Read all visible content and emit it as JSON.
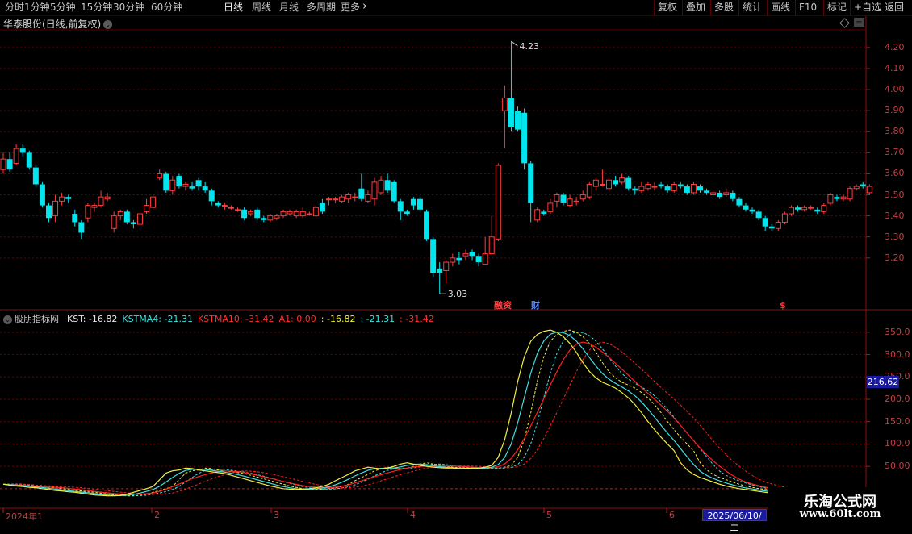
{
  "toolbar": {
    "periods": [
      "分时",
      "1分钟",
      "5分钟",
      "15分钟",
      "30分钟",
      "60分钟",
      "日线",
      "周线",
      "月线",
      "多周期",
      "更多"
    ],
    "active_period": "日线",
    "right_buttons": [
      "复权",
      "叠加",
      "多股",
      "统计",
      "画线",
      "F10",
      "标记",
      "+自选",
      "返回"
    ]
  },
  "stock": {
    "title": "华泰股份(日线,前复权)",
    "high_marker": "4.23",
    "low_marker": "3.03"
  },
  "event_markers": [
    {
      "label": "融资",
      "color": "#ff4040"
    },
    {
      "label": "财",
      "color": "#6090ff"
    },
    {
      "label": "$",
      "color": "#ff3030"
    }
  ],
  "price_axis": [
    "4.20",
    "4.10",
    "4.00",
    "3.90",
    "3.80",
    "3.70",
    "3.60",
    "3.50",
    "3.40",
    "3.30",
    "3.20"
  ],
  "indicator": {
    "name": "股朋指标网",
    "parts": [
      {
        "text": "KST: -16.82",
        "color": "#e8e8e8"
      },
      {
        "text": "KSTMA4: -21.31",
        "color": "#40e0e0"
      },
      {
        "text": "KSTMA10: -31.42",
        "color": "#ff3030"
      },
      {
        "text": "A1: 0.00",
        "color": "#ff3030"
      },
      {
        "text": ": -16.82",
        "color": "#f0f040"
      },
      {
        "text": ": -21.31",
        "color": "#40e0e0"
      },
      {
        "text": ": -31.42",
        "color": "#ff3030"
      }
    ],
    "axis": [
      "350.0",
      "300.0",
      "250.0",
      "200.0",
      "150.0",
      "100.0",
      "50.00"
    ],
    "badge": "216.62"
  },
  "x_axis": {
    "labels": [
      "2024年1",
      "2",
      "3",
      "4",
      "5",
      "6"
    ],
    "date_badge": "2025/06/10/二"
  },
  "watermark": {
    "line1": "乐淘公式网",
    "line2": "www.60lt.com"
  },
  "colors": {
    "up": "#ff3c3c",
    "down": "#00e5ee",
    "kst": "#f0f040",
    "kstma4": "#40e0e0",
    "kstma10": "#ff2020",
    "grid": "#700000"
  },
  "chart_data": {
    "type": "candlestick",
    "ylim": [
      3.0,
      4.28
    ],
    "candles": [
      [
        3.62,
        3.67,
        3.7,
        3.6
      ],
      [
        3.67,
        3.62,
        3.7,
        3.61
      ],
      [
        3.65,
        3.72,
        3.74,
        3.64
      ],
      [
        3.72,
        3.7,
        3.74,
        3.68
      ],
      [
        3.7,
        3.63,
        3.71,
        3.62
      ],
      [
        3.63,
        3.55,
        3.64,
        3.54
      ],
      [
        3.55,
        3.45,
        3.56,
        3.44
      ],
      [
        3.45,
        3.39,
        3.46,
        3.37
      ],
      [
        3.4,
        3.47,
        3.5,
        3.37
      ],
      [
        3.47,
        3.49,
        3.51,
        3.45
      ],
      [
        3.49,
        3.48,
        3.5,
        3.46
      ],
      [
        3.41,
        3.37,
        3.43,
        3.35
      ],
      [
        3.37,
        3.32,
        3.38,
        3.29
      ],
      [
        3.39,
        3.45,
        3.46,
        3.37
      ],
      [
        3.44,
        3.45,
        3.46,
        3.42
      ],
      [
        3.45,
        3.49,
        3.52,
        3.44
      ],
      [
        3.48,
        3.49,
        3.51,
        3.47
      ],
      [
        3.34,
        3.4,
        3.42,
        3.32
      ],
      [
        3.4,
        3.42,
        3.43,
        3.38
      ],
      [
        3.42,
        3.37,
        3.43,
        3.36
      ],
      [
        3.37,
        3.36,
        3.38,
        3.34
      ],
      [
        3.36,
        3.41,
        3.42,
        3.35
      ],
      [
        3.42,
        3.45,
        3.48,
        3.41
      ],
      [
        3.44,
        3.49,
        3.5,
        3.43
      ],
      [
        3.58,
        3.6,
        3.62,
        3.57
      ],
      [
        3.6,
        3.52,
        3.61,
        3.51
      ],
      [
        3.52,
        3.57,
        3.59,
        3.5
      ],
      [
        3.59,
        3.54,
        3.6,
        3.53
      ],
      [
        3.54,
        3.55,
        3.56,
        3.52
      ],
      [
        3.54,
        3.53,
        3.56,
        3.52
      ],
      [
        3.57,
        3.54,
        3.58,
        3.52
      ],
      [
        3.54,
        3.52,
        3.56,
        3.51
      ],
      [
        3.52,
        3.47,
        3.53,
        3.45
      ],
      [
        3.46,
        3.45,
        3.47,
        3.44
      ],
      [
        3.45,
        3.45,
        3.46,
        3.43
      ],
      [
        3.44,
        3.44,
        3.45,
        3.43
      ],
      [
        3.43,
        3.43,
        3.44,
        3.42
      ],
      [
        3.43,
        3.39,
        3.44,
        3.38
      ],
      [
        3.41,
        3.42,
        3.43,
        3.4
      ],
      [
        3.43,
        3.39,
        3.44,
        3.38
      ],
      [
        3.39,
        3.38,
        3.4,
        3.37
      ],
      [
        3.38,
        3.4,
        3.41,
        3.37
      ],
      [
        3.39,
        3.4,
        3.41,
        3.38
      ],
      [
        3.4,
        3.42,
        3.43,
        3.39
      ],
      [
        3.41,
        3.42,
        3.43,
        3.4
      ],
      [
        3.4,
        3.42,
        3.43,
        3.39
      ],
      [
        3.4,
        3.42,
        3.44,
        3.39
      ],
      [
        3.41,
        3.41,
        3.42,
        3.4
      ],
      [
        3.4,
        3.44,
        3.45,
        3.4
      ],
      [
        3.46,
        3.42,
        3.48,
        3.41
      ],
      [
        3.48,
        3.48,
        3.49,
        3.45
      ],
      [
        3.48,
        3.48,
        3.49,
        3.46
      ],
      [
        3.47,
        3.49,
        3.5,
        3.46
      ],
      [
        3.48,
        3.5,
        3.51,
        3.46
      ],
      [
        3.49,
        3.49,
        3.51,
        3.47
      ],
      [
        3.53,
        3.48,
        3.6,
        3.47
      ],
      [
        3.47,
        3.5,
        3.52,
        3.46
      ],
      [
        3.48,
        3.56,
        3.58,
        3.45
      ],
      [
        3.51,
        3.57,
        3.59,
        3.5
      ],
      [
        3.57,
        3.52,
        3.6,
        3.51
      ],
      [
        3.56,
        3.47,
        3.57,
        3.46
      ],
      [
        3.47,
        3.42,
        3.48,
        3.38
      ],
      [
        3.42,
        3.41,
        3.43,
        3.4
      ],
      [
        3.48,
        3.45,
        3.49,
        3.43
      ],
      [
        3.48,
        3.43,
        3.49,
        3.42
      ],
      [
        3.42,
        3.29,
        3.43,
        3.28
      ],
      [
        3.29,
        3.13,
        3.3,
        3.11
      ],
      [
        3.15,
        3.13,
        3.18,
        3.03
      ],
      [
        3.14,
        3.18,
        3.19,
        3.08
      ],
      [
        3.18,
        3.2,
        3.22,
        3.16
      ],
      [
        3.2,
        3.19,
        3.23,
        3.17
      ],
      [
        3.21,
        3.22,
        3.24,
        3.19
      ],
      [
        3.23,
        3.21,
        3.24,
        3.19
      ],
      [
        3.21,
        3.18,
        3.22,
        3.16
      ],
      [
        3.17,
        3.22,
        3.3,
        3.17
      ],
      [
        3.22,
        3.3,
        3.4,
        3.22
      ],
      [
        3.29,
        3.64,
        3.65,
        3.28
      ],
      [
        3.9,
        3.96,
        4.02,
        3.72
      ],
      [
        3.96,
        3.82,
        4.23,
        3.8
      ],
      [
        3.9,
        3.81,
        3.92,
        3.8
      ],
      [
        3.89,
        3.65,
        3.91,
        3.62
      ],
      [
        3.65,
        3.46,
        3.66,
        3.37
      ],
      [
        3.38,
        3.43,
        3.44,
        3.37
      ],
      [
        3.42,
        3.41,
        3.43,
        3.4
      ],
      [
        3.42,
        3.46,
        3.48,
        3.41
      ],
      [
        3.47,
        3.5,
        3.51,
        3.44
      ],
      [
        3.5,
        3.46,
        3.51,
        3.45
      ],
      [
        3.45,
        3.48,
        3.5,
        3.44
      ],
      [
        3.47,
        3.47,
        3.49,
        3.45
      ],
      [
        3.48,
        3.5,
        3.52,
        3.47
      ],
      [
        3.49,
        3.55,
        3.56,
        3.48
      ],
      [
        3.54,
        3.57,
        3.58,
        3.52
      ],
      [
        3.55,
        3.55,
        3.62,
        3.54
      ],
      [
        3.53,
        3.57,
        3.58,
        3.52
      ],
      [
        3.57,
        3.55,
        3.59,
        3.54
      ],
      [
        3.56,
        3.58,
        3.6,
        3.55
      ],
      [
        3.58,
        3.53,
        3.59,
        3.52
      ],
      [
        3.53,
        3.52,
        3.54,
        3.5
      ],
      [
        3.52,
        3.54,
        3.56,
        3.51
      ],
      [
        3.53,
        3.55,
        3.56,
        3.52
      ],
      [
        3.54,
        3.54,
        3.56,
        3.52
      ],
      [
        3.55,
        3.54,
        3.56,
        3.53
      ],
      [
        3.54,
        3.52,
        3.55,
        3.51
      ],
      [
        3.52,
        3.55,
        3.56,
        3.51
      ],
      [
        3.55,
        3.54,
        3.56,
        3.53
      ],
      [
        3.54,
        3.51,
        3.55,
        3.5
      ],
      [
        3.51,
        3.55,
        3.56,
        3.5
      ],
      [
        3.54,
        3.52,
        3.55,
        3.51
      ],
      [
        3.52,
        3.51,
        3.53,
        3.5
      ],
      [
        3.5,
        3.51,
        3.52,
        3.49
      ],
      [
        3.51,
        3.49,
        3.52,
        3.48
      ],
      [
        3.5,
        3.51,
        3.53,
        3.49
      ],
      [
        3.51,
        3.48,
        3.52,
        3.47
      ],
      [
        3.48,
        3.45,
        3.49,
        3.44
      ],
      [
        3.45,
        3.43,
        3.46,
        3.42
      ],
      [
        3.43,
        3.42,
        3.44,
        3.41
      ],
      [
        3.42,
        3.39,
        3.43,
        3.38
      ],
      [
        3.39,
        3.35,
        3.4,
        3.33
      ],
      [
        3.35,
        3.34,
        3.36,
        3.33
      ],
      [
        3.34,
        3.37,
        3.38,
        3.33
      ],
      [
        3.37,
        3.41,
        3.42,
        3.36
      ],
      [
        3.41,
        3.44,
        3.45,
        3.4
      ],
      [
        3.44,
        3.43,
        3.45,
        3.42
      ],
      [
        3.43,
        3.44,
        3.45,
        3.42
      ],
      [
        3.44,
        3.44,
        3.45,
        3.43
      ],
      [
        3.43,
        3.42,
        3.44,
        3.41
      ],
      [
        3.42,
        3.45,
        3.46,
        3.41
      ],
      [
        3.46,
        3.5,
        3.51,
        3.45
      ],
      [
        3.49,
        3.48,
        3.5,
        3.47
      ],
      [
        3.48,
        3.49,
        3.5,
        3.47
      ],
      [
        3.48,
        3.53,
        3.54,
        3.47
      ],
      [
        3.53,
        3.54,
        3.55,
        3.52
      ],
      [
        3.55,
        3.54,
        3.56,
        3.53
      ],
      [
        3.51,
        3.54,
        3.55,
        3.5
      ]
    ],
    "indicator_ylim": [
      -40,
      375
    ],
    "kst": [
      10,
      8,
      6,
      5,
      3,
      2,
      0,
      -2,
      -4,
      -5,
      -7,
      -8,
      -10,
      -12,
      -14,
      -15,
      -16,
      -16,
      -15,
      -12,
      -8,
      -4,
      0,
      5,
      20,
      35,
      40,
      42,
      46,
      45,
      42,
      40,
      38,
      36,
      34,
      30,
      26,
      22,
      18,
      14,
      10,
      6,
      3,
      0,
      -1,
      -2,
      -1,
      0,
      2,
      5,
      10,
      18,
      25,
      32,
      40,
      44,
      48,
      46,
      44,
      46,
      50,
      55,
      58,
      55,
      52,
      50,
      48,
      47,
      46,
      46,
      45,
      45,
      46,
      46,
      48,
      52,
      70,
      110,
      170,
      240,
      295,
      330,
      345,
      352,
      355,
      350,
      340,
      325,
      305,
      282,
      262,
      248,
      238,
      232,
      225,
      215,
      203,
      188,
      170,
      150,
      132,
      115,
      100,
      85,
      58,
      42,
      32,
      25,
      20,
      15,
      10,
      6,
      3,
      0,
      -2,
      -4,
      -6,
      -8,
      -10,
      -11,
      -12,
      -13,
      -14,
      -15,
      -16,
      -16.82
    ]
  }
}
